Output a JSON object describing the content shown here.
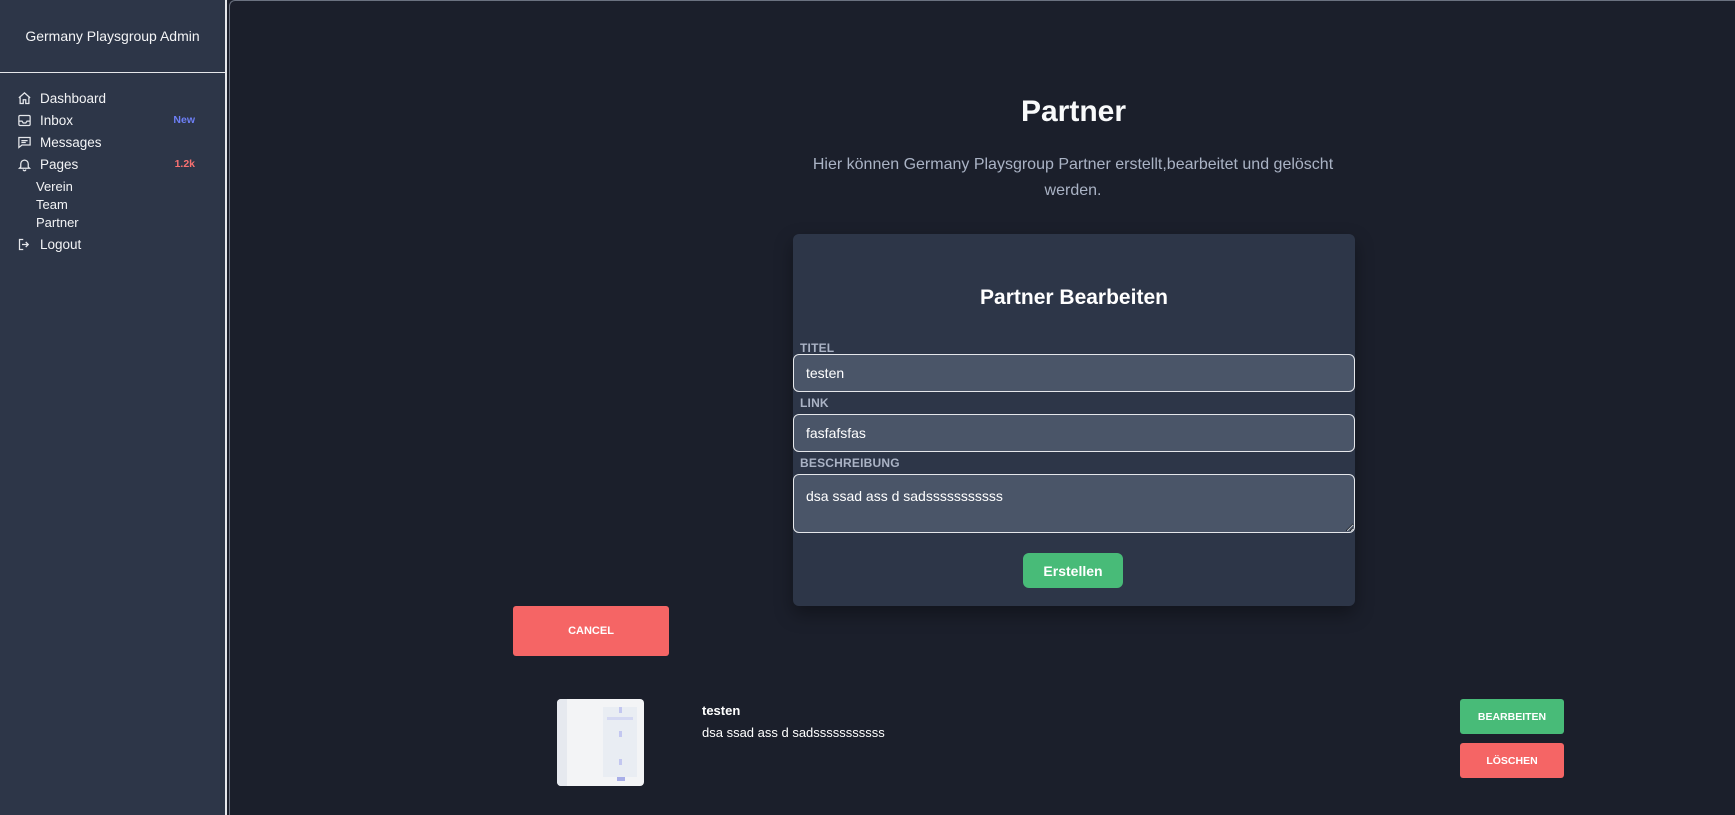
{
  "sidebar": {
    "title": "Germany Playsgroup Admin",
    "items": [
      {
        "label": "Dashboard",
        "icon": "home-icon",
        "badge": ""
      },
      {
        "label": "Inbox",
        "icon": "inbox-icon",
        "badge": "New"
      },
      {
        "label": "Messages",
        "icon": "message-icon",
        "badge": ""
      },
      {
        "label": "Pages",
        "icon": "bell-icon",
        "badge": "1.2k"
      },
      {
        "label": "Logout",
        "icon": "logout-icon",
        "badge": ""
      }
    ],
    "sub_items": [
      "Verein",
      "Team",
      "Partner"
    ],
    "badge_colors": {
      "new": "#6d7ff6",
      "count": "#f87171"
    }
  },
  "page": {
    "title": "Partner",
    "description": "Hier können Germany Playsgroup Partner erstellt,bearbeitet und gelöscht werden."
  },
  "form": {
    "title": "Partner Bearbeiten",
    "titel_label": "TITEL",
    "titel_value": "testen",
    "link_label": "LINK",
    "link_value": "fasfafsfas",
    "beschreibung_label": "BESCHREIBUNG",
    "beschreibung_value": "dsa ssad ass d sadsssssssssss",
    "submit_label": "Erstellen"
  },
  "cancel_label": "CANCEL",
  "partners": [
    {
      "title": "testen",
      "description": "dsa ssad ass d sadsssssssssss",
      "edit_label": "BEARBEITEN",
      "delete_label": "LÖSCHEN"
    }
  ],
  "colors": {
    "background": "#1b1f2b",
    "sidebar": "#2d3648",
    "card": "#2d3648",
    "input": "#4a5568",
    "success": "#48bb78",
    "danger": "#f56565"
  }
}
